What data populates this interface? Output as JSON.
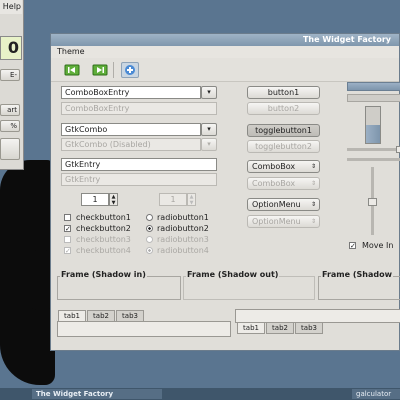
{
  "calculator": {
    "menu_help": "Help",
    "display_value": "0",
    "buttons": [
      "E-",
      "art",
      "%",
      ""
    ]
  },
  "window": {
    "title": "The Widget Factory",
    "menu": "Theme",
    "toolbar": {
      "icons": [
        "go-first-icon",
        "go-last-icon",
        "add-icon"
      ]
    },
    "left_column": {
      "combo_entry": "ComboBoxEntry",
      "combo_entry_disabled": "ComboBoxEntry",
      "gtk_combo": "GtkCombo",
      "gtk_combo_disabled": "GtkCombo (Disabled)",
      "gtk_entry": "GtkEntry",
      "gtk_entry_disabled": "GtkEntry",
      "spin_value": "1",
      "spin_value_disabled": "1",
      "checks": [
        "checkbutton1",
        "checkbutton2",
        "checkbutton3",
        "checkbutton4"
      ],
      "radios": [
        "radiobutton1",
        "radiobutton2",
        "radiobutton3",
        "radiobutton4"
      ]
    },
    "middle_column": {
      "button1": "button1",
      "button2": "button2",
      "togglebutton1": "togglebutton1",
      "togglebutton2": "togglebutton2",
      "combobox1": "ComboBox",
      "combobox2": "ComboBox",
      "optionmenu1": "OptionMenu",
      "optionmenu2": "OptionMenu"
    },
    "right_column": {
      "move_in_label": "Move In"
    },
    "frames": [
      "Frame (Shadow in)",
      "Frame (Shadow out)",
      "Frame (Shadow"
    ],
    "tabs_left": [
      "tab1",
      "tab2",
      "tab3"
    ],
    "tabs_right": [
      "tab1",
      "tab2",
      "tab3"
    ]
  },
  "taskbar": {
    "items": [
      "The Widget Factory",
      "galculator"
    ]
  },
  "colors": {
    "desktop": "#5a7590",
    "title_bar": "#7f97ad",
    "taskbar": "#3f566b"
  }
}
